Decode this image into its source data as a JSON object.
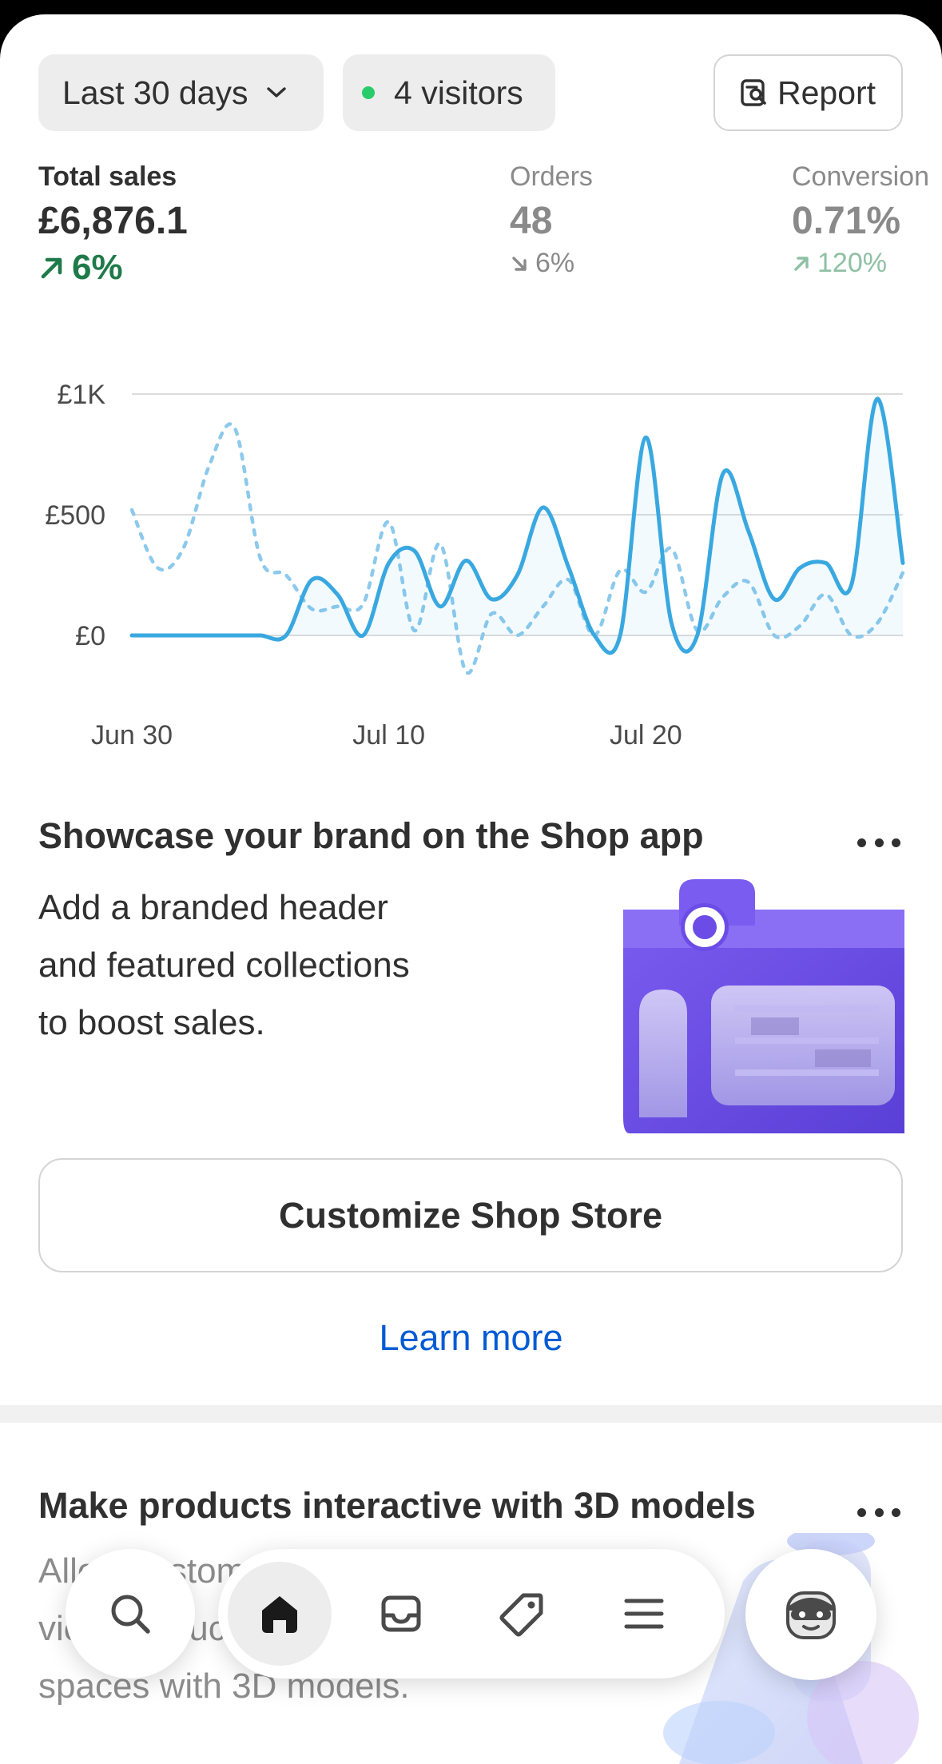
{
  "filters": {
    "date_range": "Last 30 days",
    "visitors": "4 visitors",
    "report": "Report"
  },
  "metrics": {
    "total_sales": {
      "label": "Total sales",
      "value": "£6,876.1",
      "delta": "6%",
      "trend": "up"
    },
    "orders": {
      "label": "Orders",
      "value": "48",
      "delta": "6%",
      "trend": "down"
    },
    "conversion": {
      "label": "Conversion",
      "value": "0.71%",
      "delta": "120%",
      "trend": "up"
    }
  },
  "chart_data": {
    "type": "line",
    "y_tick_labels": [
      "£1K",
      "£500",
      "£0"
    ],
    "y_tick_values": [
      1000,
      500,
      0
    ],
    "x_tick_labels": [
      "Jun 30",
      "Jul 10",
      "Jul 20"
    ],
    "x_tick_index": [
      0,
      10,
      20
    ],
    "ylim": [
      0,
      1000
    ],
    "grid": true,
    "series": [
      {
        "style": "solid",
        "color": "#3aa8e0",
        "x": [
          0,
          1,
          2,
          3,
          4,
          5,
          6,
          7,
          8,
          9,
          10,
          11,
          12,
          13,
          14,
          15,
          16,
          17,
          18,
          19,
          20,
          21,
          22,
          23,
          24,
          25,
          26,
          27,
          28,
          29,
          30
        ],
        "values": [
          0,
          0,
          0,
          0,
          0,
          0,
          0,
          230,
          170,
          0,
          300,
          350,
          120,
          310,
          150,
          250,
          530,
          280,
          0,
          0,
          820,
          50,
          0,
          670,
          430,
          150,
          280,
          300,
          210,
          980,
          300
        ]
      },
      {
        "style": "dashed",
        "color": "#8cc9ec",
        "x": [
          0,
          1,
          2,
          3,
          4,
          5,
          6,
          7,
          8,
          9,
          10,
          11,
          12,
          13,
          14,
          15,
          16,
          17,
          18,
          19,
          20,
          21,
          22,
          23,
          24,
          25,
          26,
          27,
          28,
          29,
          30
        ],
        "values": [
          520,
          280,
          360,
          700,
          860,
          320,
          250,
          110,
          120,
          130,
          470,
          20,
          380,
          -150,
          90,
          0,
          120,
          230,
          0,
          270,
          180,
          360,
          20,
          160,
          220,
          0,
          40,
          170,
          0,
          50,
          260
        ]
      }
    ]
  },
  "card_shop": {
    "title": "Showcase your brand on the Shop app",
    "body": [
      "Add a branded header",
      "and featured collections",
      "to boost sales."
    ],
    "cta": "Customize Shop Store",
    "link": "Learn more"
  },
  "card_3d": {
    "title": "Make products interactive with 3D models",
    "body": [
      "Allow customers to",
      "view products in their",
      "spaces with 3D models."
    ]
  },
  "nav": {
    "items": [
      "search-icon",
      "home-icon",
      "inbox-icon",
      "tag-icon",
      "menu-icon",
      "avatar-icon"
    ],
    "active": "home-icon"
  },
  "colors": {
    "accent_line": "#3aa8e0",
    "positive": "#1f7a4a",
    "link": "#005bd3",
    "shop_purple": "#6b4ce6"
  }
}
